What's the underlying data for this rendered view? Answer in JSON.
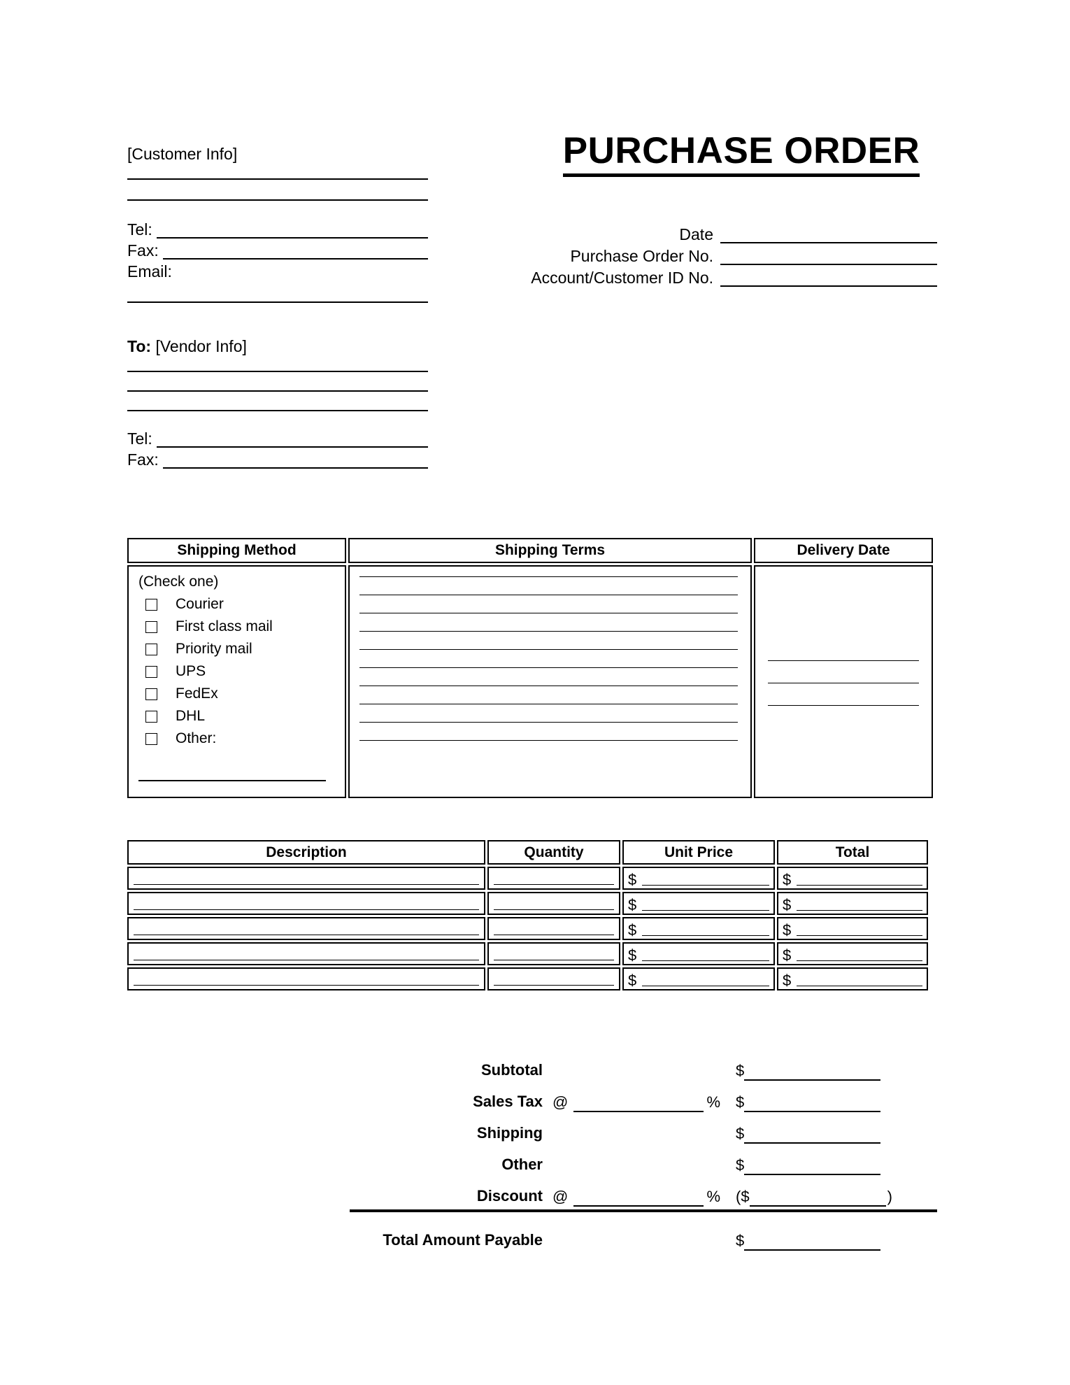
{
  "document": {
    "title": "PURCHASE ORDER"
  },
  "customer": {
    "heading": "[Customer Info]",
    "tel_label": "Tel:",
    "fax_label": "Fax:",
    "email_label": "Email:"
  },
  "meta": {
    "rows": [
      {
        "label": "Date"
      },
      {
        "label": "Purchase Order No."
      },
      {
        "label": "Account/Customer ID No."
      }
    ]
  },
  "vendor": {
    "to_label": "To:",
    "heading": "[Vendor Info]",
    "tel_label": "Tel:",
    "fax_label": "Fax:"
  },
  "shipping": {
    "headers": {
      "method": "Shipping Method",
      "terms": "Shipping Terms",
      "delivery_date": "Delivery Date"
    },
    "check_hint": "(Check one)",
    "options": [
      "Courier",
      "First class mail",
      "Priority mail",
      "UPS",
      "FedEx",
      "DHL",
      "Other:"
    ]
  },
  "items": {
    "headers": [
      "Description",
      "Quantity",
      "Unit Price",
      "Total"
    ],
    "currency_symbol": "$",
    "row_count": 5
  },
  "totals": {
    "rows": [
      {
        "label": "Subtotal",
        "rate": false,
        "currency": "$",
        "close_paren": ""
      },
      {
        "label": "Sales Tax",
        "rate": true,
        "currency": "$",
        "close_paren": ""
      },
      {
        "label": "Shipping",
        "rate": false,
        "currency": "$",
        "close_paren": ""
      },
      {
        "label": "Other",
        "rate": false,
        "currency": "$",
        "close_paren": ""
      },
      {
        "label": "Discount",
        "rate": true,
        "currency": "($",
        "close_paren": ")"
      }
    ],
    "at_symbol": "@",
    "percent_symbol": "%",
    "grand_total_label": "Total Amount Payable",
    "grand_total_currency": "$"
  },
  "colors": {
    "ink": "#000000",
    "paper": "#ffffff"
  }
}
